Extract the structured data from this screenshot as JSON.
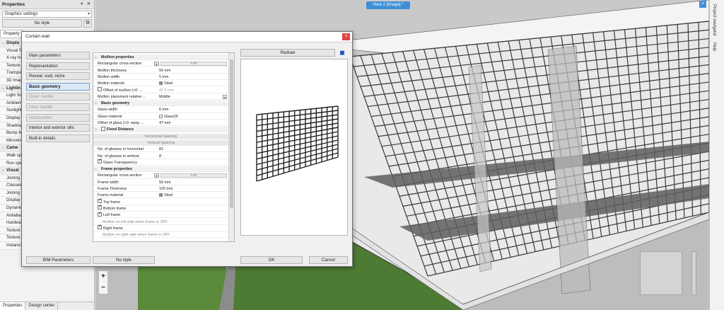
{
  "properties": {
    "title": "Properties",
    "selector_value": "Graphics settings",
    "style_button": "No style",
    "tab_label": "Property",
    "rows": [
      {
        "label": "Displa",
        "section": true
      },
      {
        "label": "Visual St",
        "section": false
      },
      {
        "label": "X-ray tra",
        "section": false
      },
      {
        "label": "Texture",
        "section": false
      },
      {
        "label": "Transpar",
        "section": false
      },
      {
        "label": "3D Imag",
        "section": false
      },
      {
        "label": "Lightin",
        "section": true
      },
      {
        "label": "Light Sch",
        "section": false
      },
      {
        "label": "Ambient",
        "section": false
      },
      {
        "label": "Sunlight",
        "section": false
      },
      {
        "label": "Display li",
        "section": false
      },
      {
        "label": "Shadow",
        "section": false
      },
      {
        "label": "Bump Ma",
        "section": false
      },
      {
        "label": "Mirroring",
        "section": false
      },
      {
        "label": "Came",
        "section": true
      },
      {
        "label": "Walk spe",
        "section": false
      },
      {
        "label": "Run spee",
        "section": false
      },
      {
        "label": "Visual",
        "section": true
      },
      {
        "label": "Joining S",
        "section": false
      },
      {
        "label": "Classes",
        "section": false
      },
      {
        "label": "Joining S",
        "section": false
      },
      {
        "label": "Display c",
        "section": false
      },
      {
        "label": "Dynamic",
        "section": false
      },
      {
        "label": "Antialias",
        "section": false
      },
      {
        "label": "Hardwar",
        "section": false
      },
      {
        "label": "Texture",
        "section": false
      },
      {
        "label": "Texture",
        "section": false
      },
      {
        "label": "Instancin",
        "section": false
      }
    ],
    "bottom_tabs": [
      "Properties",
      "Design center"
    ]
  },
  "viewport": {
    "view_label": "View 2 [Image] *",
    "close_glyph": "×",
    "zoom_in": "+",
    "zoom_out": "−"
  },
  "side_tabs": [
    "Project navigator",
    "Help"
  ],
  "dialog": {
    "title": "Curtain wall",
    "close_glyph": "×",
    "nav": [
      {
        "label": "Main parameters",
        "state": "normal"
      },
      {
        "label": "Representation",
        "state": "normal"
      },
      {
        "label": "Reveal, void, niche",
        "state": "normal"
      },
      {
        "label": "Basic geometry",
        "state": "active"
      },
      {
        "label": "Outer handle",
        "state": "disabled"
      },
      {
        "label": "Inner handle",
        "state": "disabled"
      },
      {
        "label": "Accessories",
        "state": "disabled"
      },
      {
        "label": "Interior and exterior sills",
        "state": "normal"
      },
      {
        "label": "Built-in details",
        "state": "normal"
      }
    ],
    "grid": [
      {
        "kind": "section",
        "label": "Mullion properties"
      },
      {
        "kind": "edit",
        "label": "Rectangular cross-section",
        "button": "Edit"
      },
      {
        "kind": "value",
        "label": "Mullion thickness",
        "value": "50 mm"
      },
      {
        "kind": "value",
        "label": "Mullion width",
        "value": "5 mm"
      },
      {
        "kind": "material",
        "label": "Mullion material",
        "value": "Steel",
        "swatch": "#8c8c8c"
      },
      {
        "kind": "check",
        "label": "Offset of mullion (>0: ...",
        "checked": false,
        "value": "47.5 mm",
        "dim": true
      },
      {
        "kind": "dropdown",
        "label": "Mullion placement relative ...",
        "value": "Middle"
      },
      {
        "kind": "section",
        "label": "Basic geometry"
      },
      {
        "kind": "value",
        "label": "Glass width",
        "value": "6 mm"
      },
      {
        "kind": "material",
        "label": "Glass material",
        "value": "Glass26",
        "swatch": "#ffffff"
      },
      {
        "kind": "value",
        "label": "Offset of glass (>0: away ...",
        "value": "47 mm"
      },
      {
        "kind": "checksection",
        "label": "Fixed Distance",
        "checked": false
      },
      {
        "kind": "full",
        "label": "Horizontal Spacing"
      },
      {
        "kind": "full",
        "label": "Vertical Spacing"
      },
      {
        "kind": "value",
        "label": "No. of glasses in horizontal:",
        "value": "81"
      },
      {
        "kind": "value",
        "label": "No. of glasses in vertical:",
        "value": "8"
      },
      {
        "kind": "check",
        "label": "Glass Transparency",
        "checked": true,
        "value": ""
      },
      {
        "kind": "section",
        "label": "Frame properties"
      },
      {
        "kind": "edit",
        "label": "Rectangular cross-section",
        "button": "Edit"
      },
      {
        "kind": "value",
        "label": "Frame width",
        "value": "50 mm"
      },
      {
        "kind": "value",
        "label": "Frame Thickness",
        "value": "100 mm"
      },
      {
        "kind": "material",
        "label": "Frame material",
        "value": "Steel",
        "swatch": "#8c8c8c"
      },
      {
        "kind": "check",
        "label": "Top frame",
        "checked": true,
        "value": ""
      },
      {
        "kind": "check",
        "label": "Bottom frame",
        "checked": true,
        "value": ""
      },
      {
        "kind": "check",
        "label": "Left frame",
        "checked": true,
        "value": ""
      },
      {
        "kind": "note",
        "label": "Mullion on left side when frame is OFF"
      },
      {
        "kind": "check",
        "label": "Right frame",
        "checked": true,
        "value": ""
      },
      {
        "kind": "note",
        "label": "Mullion on right side when frame is OFF"
      }
    ],
    "redraw": "Redraw",
    "bim_parameters": "BIM Parameters",
    "no_style": "No style",
    "ok": "OK",
    "cancel": "Cancel"
  }
}
